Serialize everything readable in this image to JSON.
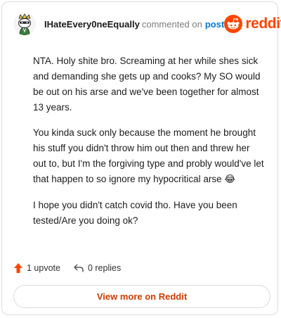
{
  "header": {
    "username": "IHateEvery0neEqually",
    "action_text": "commented on",
    "post_link": "post",
    "brand": "reddit"
  },
  "comment": {
    "paragraphs": [
      "NTA. Holy shite bro. Screaming at her while shes sick and demanding she gets up and cooks? My SO would be out on his arse and we've been together for almost 13 years.",
      "You kinda suck only because the moment he brought his stuff you didn't throw him out then and threw her out to, but I'm the forgiving type and probly would've let that happen to so ignore my hypocritical arse 😂",
      "I hope you didn't catch covid tho. Have you been tested/Are you doing ok?"
    ]
  },
  "actions": {
    "upvote_label": "1 upvote",
    "replies_label": "0 replies"
  },
  "footer": {
    "view_more_label": "View more on Reddit"
  },
  "colors": {
    "accent": "#ff4500",
    "link": "#0079d3",
    "button_text": "#cc3a00"
  },
  "icons": {
    "avatar": "snoo-avatar-icon",
    "brand": "reddit-logo-icon",
    "upvote": "upvote-arrow-icon",
    "reply": "reply-arrow-icon"
  }
}
